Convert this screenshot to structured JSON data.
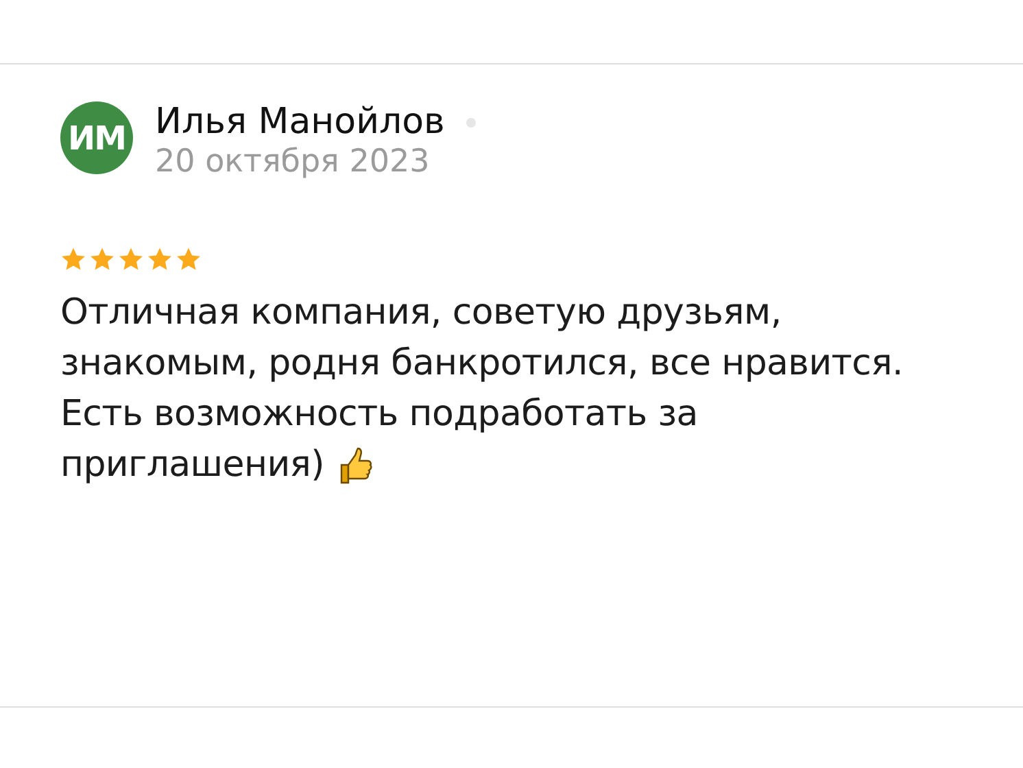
{
  "review": {
    "avatar": {
      "initials": "ИМ"
    },
    "author": "Илья Манойлов",
    "date": "20 октября 2023",
    "stars": 5,
    "text": "Отличная компания, советую друзьям,\nзнакомым, родня банкротился, все нравится.\nЕсть возможность подработать за\nприглашения)"
  }
}
